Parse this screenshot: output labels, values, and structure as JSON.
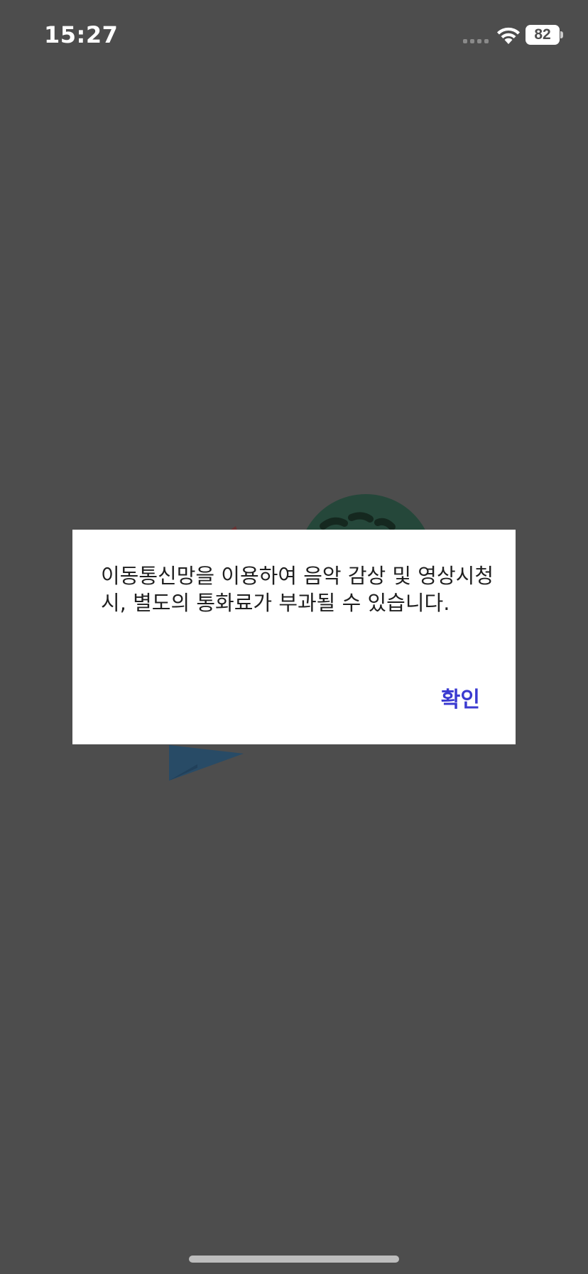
{
  "status_bar": {
    "time": "15:27",
    "battery_level": "82",
    "signal_icon": "cellular-dots-icon",
    "wifi_icon": "wifi-icon"
  },
  "dialog": {
    "message": "이동통신망을 이용하여 음악 감상 및 영상시청 시, 별도의 통화료가 부과될 수 있습니다.",
    "confirm_label": "확인"
  },
  "colors": {
    "overlay_background": "#4d4d4d",
    "dialog_background": "#ffffff",
    "accent": "#3a3ad0"
  }
}
